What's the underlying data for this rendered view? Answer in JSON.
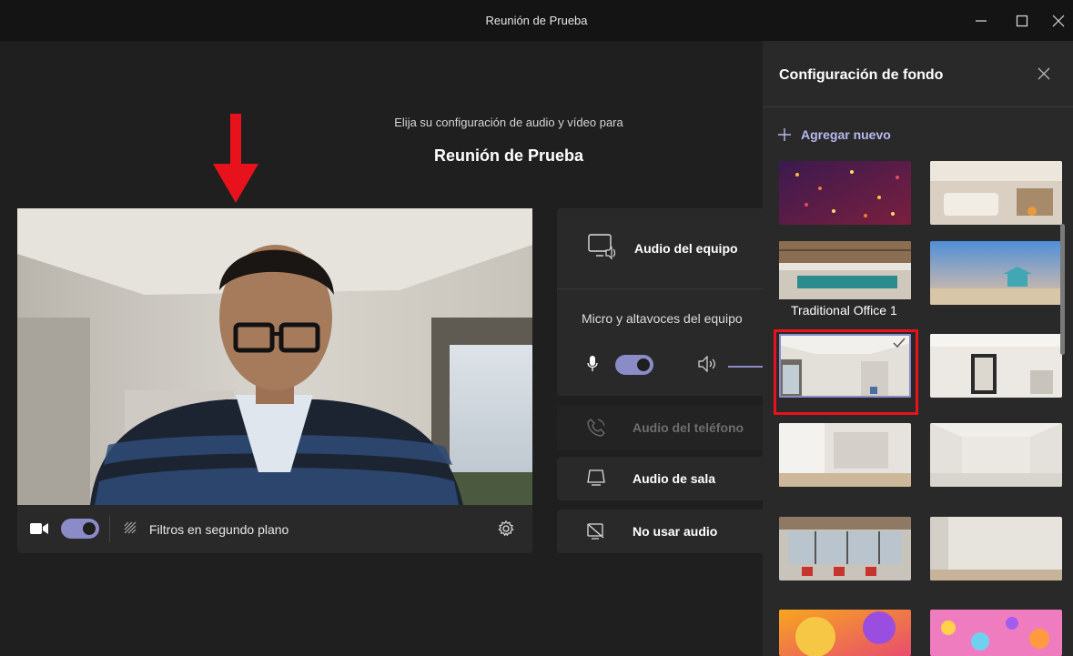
{
  "window": {
    "title": "Reunión de Prueba"
  },
  "prejoin": {
    "subtitle": "Elija su configuración de audio y vídeo para",
    "meeting_name": "Reunión de Prueba"
  },
  "video_bar": {
    "camera_on": true,
    "filters_label": "Filtros en segundo plano"
  },
  "audio": {
    "computer": {
      "label": "Audio del equipo",
      "device": "Micro y altavoces del equipo",
      "mic_on": true
    },
    "phone": {
      "label": "Audio del teléfono",
      "disabled": true
    },
    "room": {
      "label": "Audio de sala"
    },
    "none": {
      "label": "No usar audio"
    }
  },
  "background_panel": {
    "title": "Configuración de fondo",
    "add_new_label": "Agregar nuevo",
    "tooltip": "Traditional Office 1",
    "selected_index": 4,
    "backgrounds": [
      {
        "theme": "confetti-purple"
      },
      {
        "theme": "cozy-bedroom"
      },
      {
        "theme": "modern-office-ceiling"
      },
      {
        "theme": "beach-lifeguard-tower"
      },
      {
        "theme": "traditional-office-1"
      },
      {
        "theme": "white-room-mirror"
      },
      {
        "theme": "white-loft"
      },
      {
        "theme": "white-minimal-room"
      },
      {
        "theme": "office-windows-red-chairs"
      },
      {
        "theme": "white-wall-room"
      },
      {
        "theme": "orange-abstract"
      },
      {
        "theme": "pink-bubbles"
      }
    ]
  },
  "colors": {
    "accent": "#8b8cc7",
    "highlight": "#e8121d",
    "panel_bg": "#292929",
    "app_bg": "#1f1f1f"
  }
}
